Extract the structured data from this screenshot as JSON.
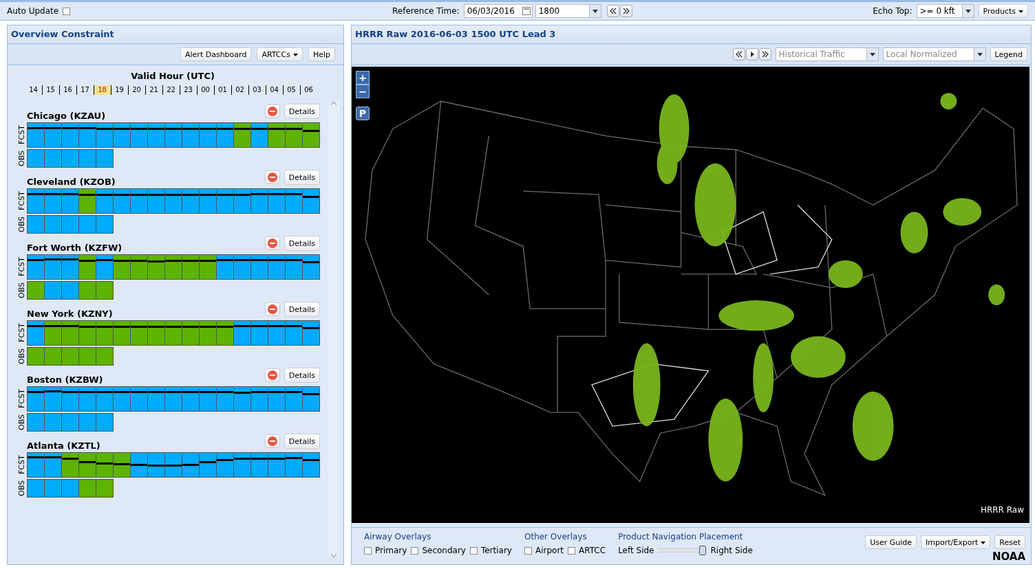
{
  "top_bar": {
    "auto_update": {
      "label": "Auto Update",
      "checked": false
    },
    "reference_time": {
      "label": "Reference Time:",
      "date": "06/03/2016",
      "time": "1800"
    },
    "echo_top": {
      "label": "Echo Top:",
      "value": ">= 0 kft"
    },
    "products_button": "Products"
  },
  "left_panel": {
    "title": "Overview Constraint",
    "buttons": [
      {
        "label": "Alert Dashboard",
        "dropdown": false
      },
      {
        "label": "ARTCCs",
        "dropdown": true
      },
      {
        "label": "Help",
        "dropdown": false
      }
    ],
    "hours_title": "Valid Hour (UTC)",
    "hours": [
      {
        "label": "14",
        "selected": false
      },
      {
        "label": "15",
        "selected": false
      },
      {
        "label": "16",
        "selected": false
      },
      {
        "label": "17",
        "selected": false
      },
      {
        "label": "18",
        "selected": true
      },
      {
        "label": "19",
        "selected": false
      },
      {
        "label": "20",
        "selected": false
      },
      {
        "label": "21",
        "selected": false
      },
      {
        "label": "22",
        "selected": false
      },
      {
        "label": "23",
        "selected": false
      },
      {
        "label": "00",
        "selected": false
      },
      {
        "label": "01",
        "selected": false
      },
      {
        "label": "02",
        "selected": false
      },
      {
        "label": "03",
        "selected": false
      },
      {
        "label": "04",
        "selected": false
      },
      {
        "label": "05",
        "selected": false
      },
      {
        "label": "06",
        "selected": false
      }
    ],
    "fcst_label": [
      "FCST",
      "FCST",
      "FCST",
      "FCST",
      "FCST",
      "FCST"
    ],
    "obs_label": [
      "OBS",
      "OBS",
      "OBS",
      "OBS",
      "OBS",
      "OBS"
    ],
    "details_label": [
      "Details",
      "Details",
      "Details",
      "Details",
      "Details",
      "Details"
    ],
    "centers": [
      {
        "name": "Chicago (KZAU)",
        "fcst": [
          {
            "color": "#00aaff",
            "level": 0.85
          },
          {
            "color": "#00aaff",
            "level": 0.85
          },
          {
            "color": "#00aaff",
            "level": 0.85
          },
          {
            "color": "#00aaff",
            "level": 0.85
          },
          {
            "color": "#00aaff",
            "level": 0.8
          },
          {
            "color": "#00aaff",
            "level": 0.8
          },
          {
            "color": "#00aaff",
            "level": 0.8
          },
          {
            "color": "#00aaff",
            "level": 0.8
          },
          {
            "color": "#00aaff",
            "level": 0.8
          },
          {
            "color": "#00aaff",
            "level": 0.8
          },
          {
            "color": "#00aaff",
            "level": 0.8
          },
          {
            "color": "#00aaff",
            "level": 0.8
          },
          {
            "color": "#5cb300",
            "level": 0.8
          },
          {
            "color": "#00aaff",
            "level": 0.8
          },
          {
            "color": "#5cb300",
            "level": 0.82
          },
          {
            "color": "#5cb300",
            "level": 0.82
          },
          {
            "color": "#5cb300",
            "level": 0.72
          }
        ],
        "obs": [
          {
            "color": "#00aaff"
          },
          {
            "color": "#00aaff"
          },
          {
            "color": "#00aaff"
          },
          {
            "color": "#00aaff"
          },
          {
            "color": "#00aaff"
          }
        ]
      },
      {
        "name": "Cleveland (KZOB)",
        "fcst": [
          {
            "color": "#00aaff",
            "level": 0.85
          },
          {
            "color": "#00aaff",
            "level": 0.85
          },
          {
            "color": "#00aaff",
            "level": 0.85
          },
          {
            "color": "#5cb300",
            "level": 0.8
          },
          {
            "color": "#00aaff",
            "level": 0.8
          },
          {
            "color": "#00aaff",
            "level": 0.8
          },
          {
            "color": "#00aaff",
            "level": 0.8
          },
          {
            "color": "#00aaff",
            "level": 0.8
          },
          {
            "color": "#00aaff",
            "level": 0.8
          },
          {
            "color": "#00aaff",
            "level": 0.8
          },
          {
            "color": "#00aaff",
            "level": 0.8
          },
          {
            "color": "#00aaff",
            "level": 0.8
          },
          {
            "color": "#00aaff",
            "level": 0.8
          },
          {
            "color": "#00aaff",
            "level": 0.85
          },
          {
            "color": "#00aaff",
            "level": 0.85
          },
          {
            "color": "#00aaff",
            "level": 0.85
          },
          {
            "color": "#00aaff",
            "level": 0.7
          }
        ],
        "obs": [
          {
            "color": "#00aaff"
          },
          {
            "color": "#00aaff"
          },
          {
            "color": "#00aaff"
          },
          {
            "color": "#00aaff"
          },
          {
            "color": "#00aaff"
          }
        ]
      },
      {
        "name": "Fort Worth (KZFW)",
        "fcst": [
          {
            "color": "#00aaff",
            "level": 0.85
          },
          {
            "color": "#00aaff",
            "level": 0.88
          },
          {
            "color": "#00aaff",
            "level": 0.88
          },
          {
            "color": "#5cb300",
            "level": 0.82
          },
          {
            "color": "#00aaff",
            "level": 0.85
          },
          {
            "color": "#5cb300",
            "level": 0.82
          },
          {
            "color": "#5cb300",
            "level": 0.82
          },
          {
            "color": "#5cb300",
            "level": 0.78
          },
          {
            "color": "#5cb300",
            "level": 0.8
          },
          {
            "color": "#5cb300",
            "level": 0.8
          },
          {
            "color": "#5cb300",
            "level": 0.82
          },
          {
            "color": "#00aaff",
            "level": 0.85
          },
          {
            "color": "#00aaff",
            "level": 0.85
          },
          {
            "color": "#00aaff",
            "level": 0.85
          },
          {
            "color": "#00aaff",
            "level": 0.85
          },
          {
            "color": "#00aaff",
            "level": 0.85
          },
          {
            "color": "#00aaff",
            "level": 0.75
          }
        ],
        "obs": [
          {
            "color": "#5cb300"
          },
          {
            "color": "#00aaff"
          },
          {
            "color": "#00aaff"
          },
          {
            "color": "#5cb300"
          },
          {
            "color": "#5cb300"
          }
        ]
      },
      {
        "name": "New York (KZNY)",
        "fcst": [
          {
            "color": "#00aaff",
            "level": 0.85
          },
          {
            "color": "#5cb300",
            "level": 0.85
          },
          {
            "color": "#5cb300",
            "level": 0.85
          },
          {
            "color": "#5cb300",
            "level": 0.82
          },
          {
            "color": "#5cb300",
            "level": 0.82
          },
          {
            "color": "#5cb300",
            "level": 0.82
          },
          {
            "color": "#5cb300",
            "level": 0.82
          },
          {
            "color": "#5cb300",
            "level": 0.82
          },
          {
            "color": "#5cb300",
            "level": 0.82
          },
          {
            "color": "#5cb300",
            "level": 0.82
          },
          {
            "color": "#5cb300",
            "level": 0.82
          },
          {
            "color": "#5cb300",
            "level": 0.82
          },
          {
            "color": "#00aaff",
            "level": 0.85
          },
          {
            "color": "#00aaff",
            "level": 0.85
          },
          {
            "color": "#00aaff",
            "level": 0.85
          },
          {
            "color": "#00aaff",
            "level": 0.85
          },
          {
            "color": "#00aaff",
            "level": 0.75
          }
        ],
        "obs": [
          {
            "color": "#5cb300"
          },
          {
            "color": "#5cb300"
          },
          {
            "color": "#5cb300"
          },
          {
            "color": "#5cb300"
          },
          {
            "color": "#5cb300"
          }
        ]
      },
      {
        "name": "Boston (KZBW)",
        "fcst": [
          {
            "color": "#00aaff",
            "level": 0.85
          },
          {
            "color": "#00aaff",
            "level": 0.88
          },
          {
            "color": "#00aaff",
            "level": 0.85
          },
          {
            "color": "#00aaff",
            "level": 0.85
          },
          {
            "color": "#00aaff",
            "level": 0.85
          },
          {
            "color": "#00aaff",
            "level": 0.85
          },
          {
            "color": "#00aaff",
            "level": 0.85
          },
          {
            "color": "#00aaff",
            "level": 0.85
          },
          {
            "color": "#00aaff",
            "level": 0.85
          },
          {
            "color": "#00aaff",
            "level": 0.85
          },
          {
            "color": "#00aaff",
            "level": 0.85
          },
          {
            "color": "#00aaff",
            "level": 0.85
          },
          {
            "color": "#00aaff",
            "level": 0.82
          },
          {
            "color": "#00aaff",
            "level": 0.85
          },
          {
            "color": "#00aaff",
            "level": 0.85
          },
          {
            "color": "#00aaff",
            "level": 0.85
          },
          {
            "color": "#00aaff",
            "level": 0.75
          }
        ],
        "obs": [
          {
            "color": "#00aaff"
          },
          {
            "color": "#00aaff"
          },
          {
            "color": "#00aaff"
          },
          {
            "color": "#00aaff"
          },
          {
            "color": "#00aaff"
          }
        ]
      },
      {
        "name": "Atlanta (KZTL)",
        "fcst": [
          {
            "color": "#00aaff",
            "level": 0.88
          },
          {
            "color": "#00aaff",
            "level": 0.88
          },
          {
            "color": "#5cb300",
            "level": 0.82
          },
          {
            "color": "#5cb300",
            "level": 0.65
          },
          {
            "color": "#5cb300",
            "level": 0.58
          },
          {
            "color": "#5cb300",
            "level": 0.55
          },
          {
            "color": "#00aaff",
            "level": 0.52
          },
          {
            "color": "#00aaff",
            "level": 0.48
          },
          {
            "color": "#00aaff",
            "level": 0.48
          },
          {
            "color": "#00aaff",
            "level": 0.52
          },
          {
            "color": "#00aaff",
            "level": 0.65
          },
          {
            "color": "#00aaff",
            "level": 0.75
          },
          {
            "color": "#00aaff",
            "level": 0.8
          },
          {
            "color": "#00aaff",
            "level": 0.82
          },
          {
            "color": "#00aaff",
            "level": 0.82
          },
          {
            "color": "#00aaff",
            "level": 0.85
          },
          {
            "color": "#00aaff",
            "level": 0.75
          }
        ],
        "obs": [
          {
            "color": "#00aaff"
          },
          {
            "color": "#00aaff"
          },
          {
            "color": "#00aaff"
          },
          {
            "color": "#5cb300"
          },
          {
            "color": "#5cb300"
          }
        ]
      }
    ]
  },
  "right_panel": {
    "title": "HRRR Raw 2016-06-03 1500 UTC Lead 3",
    "traffic_select": "Historical Traffic",
    "normalization_select": "Local Normalized",
    "legend_button": "Legend",
    "map": {
      "zoom_in": "+",
      "zoom_out": "−",
      "pin_button": "P",
      "product_label": "HRRR Raw"
    },
    "airway_overlays": {
      "title": "Airway Overlays",
      "options": [
        {
          "label": "Primary",
          "checked": false
        },
        {
          "label": "Secondary",
          "checked": false
        },
        {
          "label": "Tertiary",
          "checked": false
        }
      ]
    },
    "other_overlays": {
      "title": "Other Overlays",
      "options": [
        {
          "label": "Airport",
          "checked": false
        },
        {
          "label": "ARTCC",
          "checked": false
        }
      ]
    },
    "navigation_placement": {
      "title": "Product Navigation Placement",
      "left": "Left Side",
      "right": "Right Side",
      "level": 1
    },
    "buttons": [
      {
        "label": "User Guide",
        "dropdown": false
      },
      {
        "label": "Import/Export",
        "dropdown": true
      },
      {
        "label": "Reset",
        "dropdown": false
      }
    ],
    "brand": "NOAA"
  }
}
